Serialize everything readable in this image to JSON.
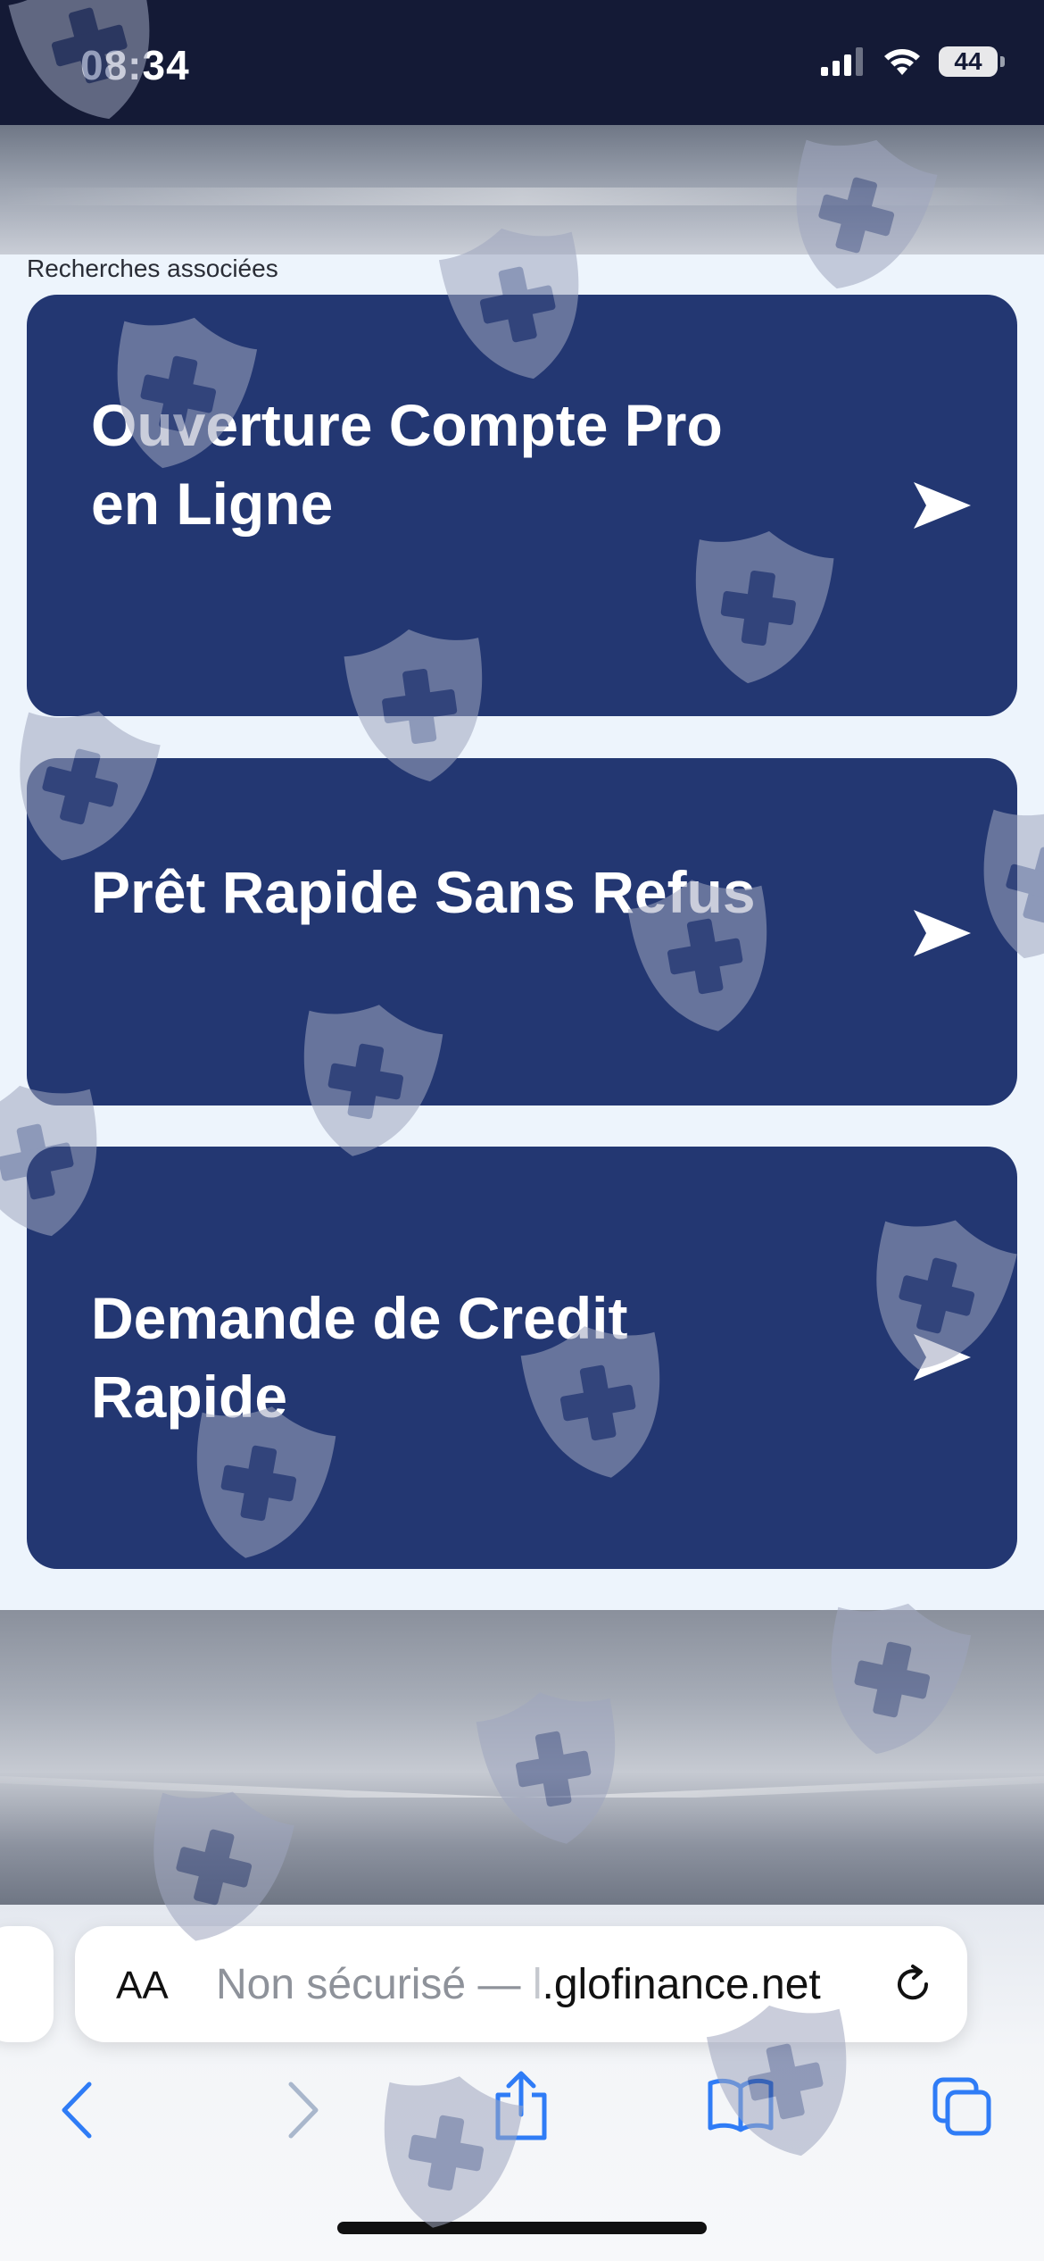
{
  "status_bar": {
    "time": "08:34",
    "battery": "44"
  },
  "section_label": "Recherches associées",
  "cards": [
    {
      "title_line1": "Ouverture Compte Pro",
      "title_line2": "en Ligne"
    },
    {
      "title_line1": "Prêt Rapide Sans Refus",
      "title_line2": ""
    },
    {
      "title_line1": "Demande de Credit",
      "title_line2": "Rapide"
    }
  ],
  "browser": {
    "text_size_button": "AA",
    "url_prefix": "Non sécurisé —",
    "url_sep": "l",
    "url_domain": ".glofinance.net"
  },
  "colors": {
    "card": "#233772",
    "status_bar": "#141a36",
    "toolbar_accent": "#2f7cf6"
  },
  "icons": [
    "signal-icon",
    "wifi-icon",
    "battery-icon",
    "send-arrow-icon",
    "reload-icon",
    "back-icon",
    "forward-icon",
    "share-icon",
    "bookmarks-icon",
    "tabs-icon",
    "shield-watermark-icon"
  ]
}
